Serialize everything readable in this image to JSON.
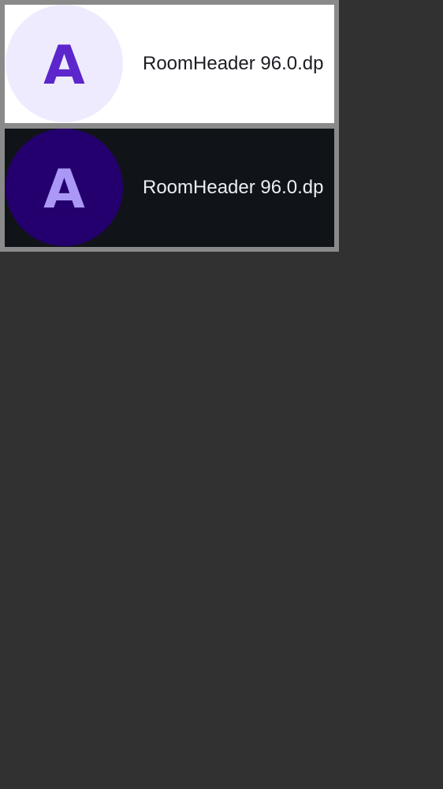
{
  "theme": {
    "outer_background": "#313131",
    "frame_color": "#8a8a8a"
  },
  "previews": [
    {
      "variant": "light",
      "background": "#ffffff",
      "avatar_background": "#efebff",
      "avatar_color": "#5c26cc",
      "text_color": "#1b1d22",
      "avatar_letter": "A",
      "label": "RoomHeader 96.0.dp"
    },
    {
      "variant": "dark",
      "background": "#101318",
      "avatar_background": "#24006e",
      "avatar_color": "#ab97f5",
      "text_color": "#ebeef2",
      "avatar_letter": "A",
      "label": "RoomHeader 96.0.dp"
    }
  ]
}
